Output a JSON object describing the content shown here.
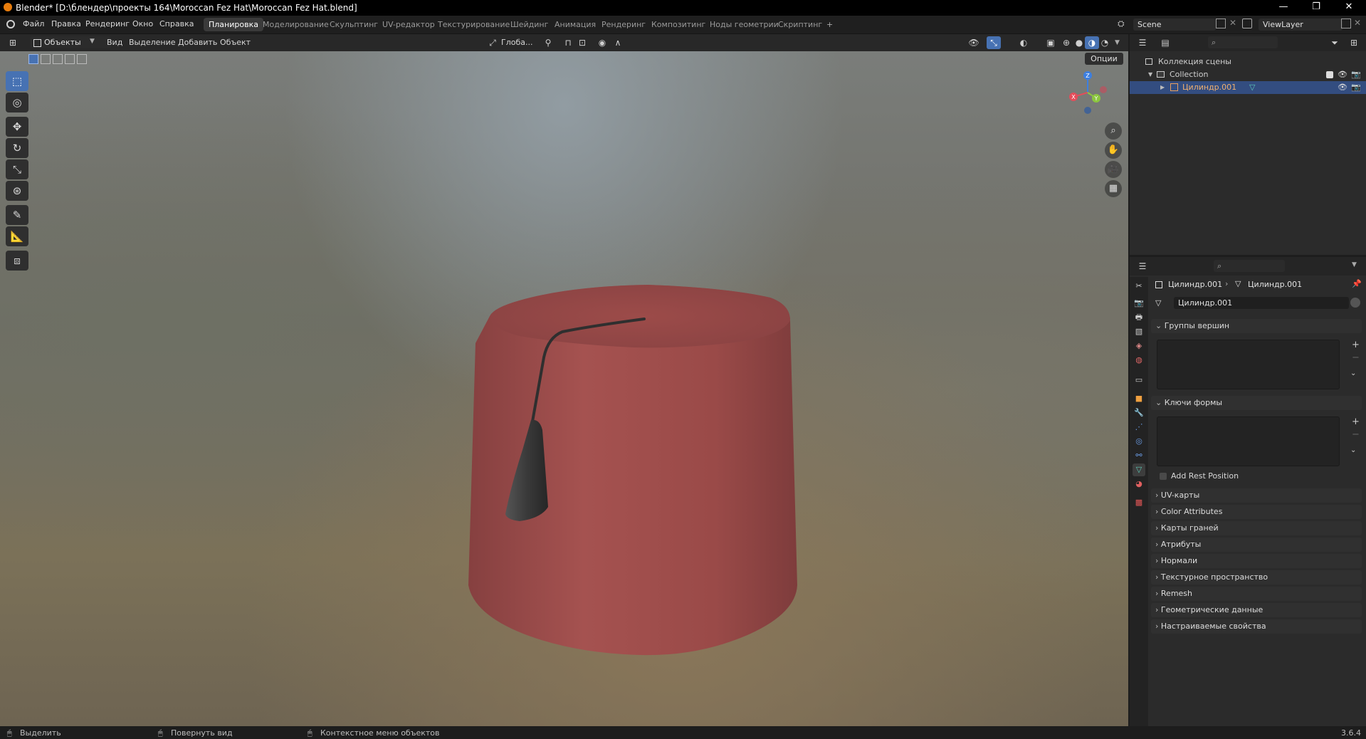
{
  "titlebar": {
    "title": "Blender* [D:\\блендер\\проекты 164\\Moroccan Fez Hat\\Moroccan Fez Hat.blend]",
    "minimize": "—",
    "maximize": "❐",
    "close": "✕"
  },
  "menu": {
    "items": [
      "Файл",
      "Правка",
      "Рендеринг",
      "Окно",
      "Справка"
    ]
  },
  "workspaces": {
    "tabs": [
      "Планировка",
      "Моделирование",
      "Скульптинг",
      "UV-редактор",
      "Текстурирование",
      "Шейдинг",
      "Анимация",
      "Рендеринг",
      "Композитинг",
      "Ноды геометрии",
      "Скриптинг"
    ],
    "active_index": 0,
    "add": "+"
  },
  "scene": {
    "name": "Scene",
    "view_layer": "ViewLayer"
  },
  "viewport_header": {
    "mode": "Объекты",
    "menus": [
      "Вид",
      "Выделение",
      "Добавить",
      "Объект"
    ],
    "orientation": "Глоба...",
    "options": "Опции"
  },
  "gizmo": {
    "x": "X",
    "y": "Y",
    "z": "Z"
  },
  "outliner": {
    "root": "Коллекция сцены",
    "collection": "Collection",
    "object": "Цилиндр.001"
  },
  "properties": {
    "breadcrumb_object": "Цилиндр.001",
    "breadcrumb_data": "Цилиндр.001",
    "data_name": "Цилиндр.001",
    "vertex_groups": "Группы вершин",
    "shape_keys": "Ключи формы",
    "add_rest_position": "Add Rest Position",
    "panels": [
      "UV-карты",
      "Color Attributes",
      "Карты граней",
      "Атрибуты",
      "Нормали",
      "Текстурное пространство",
      "Remesh",
      "Геометрические данные",
      "Настраиваемые свойства"
    ]
  },
  "statusbar": {
    "select": "Выделить",
    "rotate": "Повернуть вид",
    "context": "Контекстное меню объектов",
    "version": "3.6.4"
  },
  "colors": {
    "accent": "#4772b3",
    "hat": "#9e4a47",
    "tassel": "#3a3a3a",
    "axis_x": "#e44d5a",
    "axis_y": "#8cc63f",
    "axis_z": "#3d7fe0"
  }
}
